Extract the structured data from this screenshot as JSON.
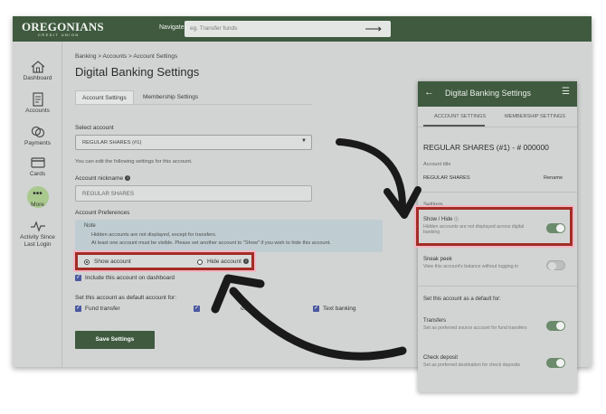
{
  "header": {
    "logo_name": "OREGONIANS",
    "logo_sub": "CREDIT UNION",
    "nav_label": "Navigate to",
    "nav_placeholder": "eg. Transfer funds"
  },
  "sidebar": {
    "items": [
      {
        "label": "Dashboard",
        "icon": "house-icon"
      },
      {
        "label": "Accounts",
        "icon": "document-icon"
      },
      {
        "label": "Payments",
        "icon": "coins-icon"
      },
      {
        "label": "Cards",
        "icon": "card-icon"
      },
      {
        "label": "More",
        "icon": "more-dots-icon"
      },
      {
        "label": "Activity Since Last Login",
        "icon": "activity-icon"
      }
    ]
  },
  "main": {
    "breadcrumb": "Banking  >  Accounts  >  Account Settings",
    "title": "Digital Banking Settings",
    "tabs": [
      "Account Settings",
      "Membership Settings"
    ],
    "select_label": "Select account",
    "select_value": "REGULAR SHARES (#1)",
    "help_text": "You can edit the following settings for this account.",
    "nickname_label": "Account nickname",
    "nickname_value": "REGULAR SHARES",
    "preferences_label": "Account Preferences",
    "note_title": "Note",
    "note_lines": [
      "Hidden accounts are not displayed, except for transfers.",
      "At least one account must be visible. Please set another account to \"Show\" if you wish to hide this account."
    ],
    "radio_show": "Show account",
    "radio_hide": "Hide account",
    "include_dashboard": "Include this account on dashboard",
    "default_label": "Set this account as default account for:",
    "default_options": [
      "Fund transfer",
      "osit",
      "Text banking"
    ],
    "save_button": "Save Settings"
  },
  "mobile": {
    "title": "Digital Banking Settings",
    "tabs": [
      "ACCOUNT SETTINGS",
      "MEMBERSHIP SETTINGS"
    ],
    "account": "REGULAR SHARES (#1) - # 000000",
    "account_title_label": "Account title",
    "account_title_value": "REGULAR SHARES",
    "rename": "Rename",
    "settings_label": "Settings",
    "show_hide_title": "Show / Hide",
    "show_hide_sub": "Hidden accounts are not displayed across digital banking",
    "sneak_peek_title": "Sneak peek",
    "sneak_peek_sub": "View this account's balance without logging in",
    "default_section": "Set this account as a default for:",
    "transfers_title": "Transfers",
    "transfers_sub": "Set as preferred source account for fund transfers",
    "check_deposit_title": "Check deposit",
    "check_deposit_sub": "Set as preferred destination for check deposits"
  },
  "colors": {
    "brand_green": "#3f5a3f",
    "highlight_red": "#a32c25",
    "highlight_pink": "#f2b6c4",
    "checkbox_blue": "#4b59a0",
    "toggle_on": "#6c8b6c"
  }
}
